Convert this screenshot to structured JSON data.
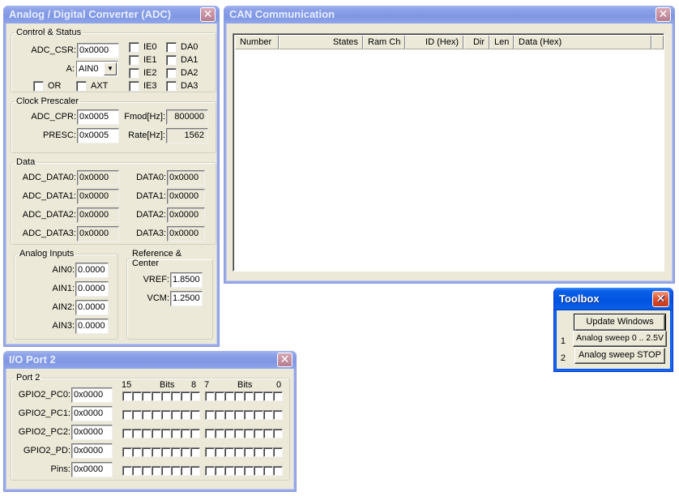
{
  "adc_window": {
    "title": "Analog / Digital Converter (ADC)",
    "control_status": {
      "legend": "Control & Status",
      "adc_csr_label": "ADC_CSR:",
      "adc_csr_value": "0x0000",
      "a_label": "A:",
      "a_selected": "AIN0",
      "checkboxes": [
        {
          "label": "OR",
          "checked": false
        },
        {
          "label": "AXT",
          "checked": false
        },
        {
          "label": "IE0",
          "checked": false
        },
        {
          "label": "IE1",
          "checked": false
        },
        {
          "label": "IE2",
          "checked": false
        },
        {
          "label": "IE3",
          "checked": false
        },
        {
          "label": "DA0",
          "checked": false
        },
        {
          "label": "DA1",
          "checked": false
        },
        {
          "label": "DA2",
          "checked": false
        },
        {
          "label": "DA3",
          "checked": false
        }
      ]
    },
    "clock_prescaler": {
      "legend": "Clock Prescaler",
      "adc_cpr_label": "ADC_CPR:",
      "adc_cpr_value": "0x0005",
      "presc_label": "PRESC:",
      "presc_value": "0x0005",
      "fmod_label": "Fmod[Hz]:",
      "fmod_value": "800000",
      "rate_label": "Rate[Hz]:",
      "rate_value": "1562"
    },
    "data": {
      "legend": "Data",
      "rows": [
        {
          "adc_label": "ADC_DATA0:",
          "adc_value": "0x0000",
          "data_label": "DATA0:",
          "data_value": "0x0000"
        },
        {
          "adc_label": "ADC_DATA1:",
          "adc_value": "0x0000",
          "data_label": "DATA1:",
          "data_value": "0x0000"
        },
        {
          "adc_label": "ADC_DATA2:",
          "adc_value": "0x0000",
          "data_label": "DATA2:",
          "data_value": "0x0000"
        },
        {
          "adc_label": "ADC_DATA3:",
          "adc_value": "0x0000",
          "data_label": "DATA3:",
          "data_value": "0x0000"
        }
      ]
    },
    "analog_inputs": {
      "legend": "Analog Inputs",
      "rows": [
        {
          "label": "AIN0:",
          "value": "0.0000"
        },
        {
          "label": "AIN1:",
          "value": "0.0000"
        },
        {
          "label": "AIN2:",
          "value": "0.0000"
        },
        {
          "label": "AIN3:",
          "value": "0.0000"
        }
      ]
    },
    "reference_center": {
      "legend": "Reference & Center",
      "vref_label": "VREF:",
      "vref_value": "1.8500",
      "vcm_label": "VCM:",
      "vcm_value": "1.2500"
    }
  },
  "can_window": {
    "title": "CAN Communication",
    "columns": [
      "Number",
      "States",
      "Ram Ch",
      "ID (Hex)",
      "Dir",
      "Len",
      "Data (Hex)",
      ""
    ],
    "rows": []
  },
  "toolbox_window": {
    "title": "Toolbox",
    "buttons": [
      {
        "label": "Update Windows",
        "index": ""
      },
      {
        "label": "Analog sweep 0 .. 2.5V",
        "index": "1"
      },
      {
        "label": "Analog sweep STOP",
        "index": "2"
      }
    ]
  },
  "io_window": {
    "title": "I/O Port 2",
    "legend": "Port 2",
    "bits_header": {
      "high_start": "15",
      "high_label": "Bits",
      "high_end": "8",
      "low_start": "7",
      "low_label": "Bits",
      "low_end": "0"
    },
    "rows": [
      {
        "label": "GPIO2_PC0:",
        "value": "0x0000"
      },
      {
        "label": "GPIO2_PC1:",
        "value": "0x0000"
      },
      {
        "label": "GPIO2_PC2:",
        "value": "0x0000"
      },
      {
        "label": "GPIO2_PD:",
        "value": "0x0000"
      },
      {
        "label": "Pins:",
        "value": "0x0000"
      }
    ]
  },
  "close_glyph": "✕"
}
